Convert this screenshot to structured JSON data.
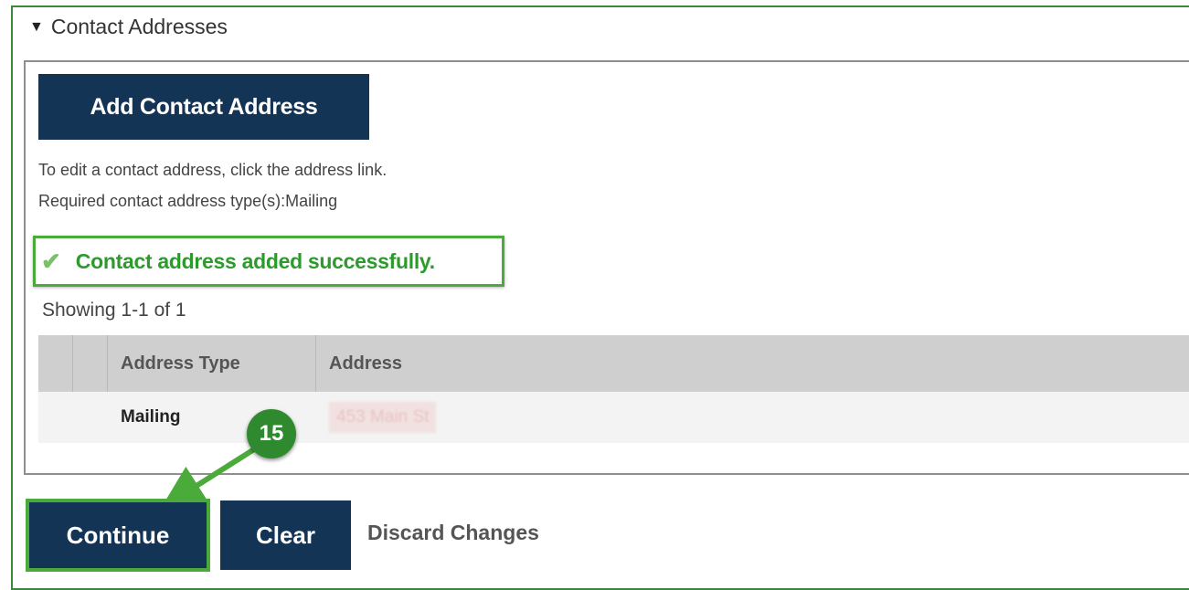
{
  "section": {
    "title": "Contact Addresses"
  },
  "actions": {
    "add_label": "Add Contact Address"
  },
  "help": {
    "line1": "To edit a contact address, click the address link.",
    "line2": "Required contact address type(s):Mailing"
  },
  "notice": {
    "message": "Contact address added successfully."
  },
  "table": {
    "showing": "Showing 1-1 of 1",
    "headers": [
      "Address Type",
      "Address"
    ],
    "rows": [
      {
        "type": "Mailing",
        "address": "453 Main St"
      }
    ]
  },
  "annotation": {
    "step": "15"
  },
  "footer": {
    "continue_label": "Continue",
    "clear_label": "Clear",
    "discard_label": "Discard Changes"
  },
  "colors": {
    "button_navy": "#143456",
    "success_green": "#2e9a2e",
    "highlight_green": "#4bab3a"
  }
}
